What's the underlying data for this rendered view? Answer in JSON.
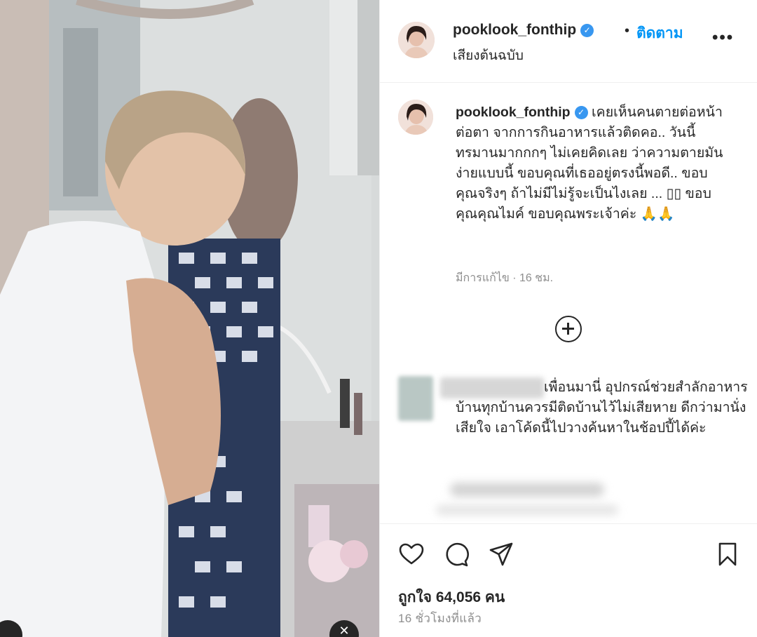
{
  "post": {
    "username": "pooklook_fonthip",
    "verified_mark": "✓",
    "separator": "•",
    "follow_label": "ติดตาม",
    "audio_label": "เสียงต้นฉบับ",
    "more_label": "•••"
  },
  "caption": {
    "username": "pooklook_fonthip",
    "text": "เคยเห็นคนตายต่อหน้าต่อตา จากการกินอาหารแล้วติดคอ.. วันนี้ทรมานมากกกๆ ไม่เคยคิดเลย ว่าความตายมันง่ายแบบนี้ ขอบคุณที่เธออยู่ตรงนี้พอดี.. ขอบคุณจริงๆ ถ้าไม่มีไม่รู้จะเป็นไงเลย ... ▯▯ ขอบคุณคุณไมค์ ขอบคุณพระเจ้าค่ะ 🙏🙏",
    "meta": "มีการแก้ไข · 16 ชม."
  },
  "comment": {
    "text": "เพื่อนมานี่ อุปกรณ์ช่วยสำลักอาหารบ้านทุกบ้านควรมีติดบ้านไว้ไม่เสียหาย ดีกว่ามานั่งเสียใจ เอาโค้ดนี้ไปวางค้นหาในช้อปปี้ได้ค่ะ"
  },
  "actions": {
    "icons": [
      "heart-icon",
      "comment-icon",
      "share-icon",
      "bookmark-icon"
    ],
    "likes": "ถูกใจ 64,056 คน",
    "time_ago": "16 ชั่วโมงที่แล้ว"
  },
  "colors": {
    "link_blue": "#0095f6",
    "verified_blue": "#3897f0",
    "text": "#262626",
    "muted": "#8e8e8e"
  }
}
